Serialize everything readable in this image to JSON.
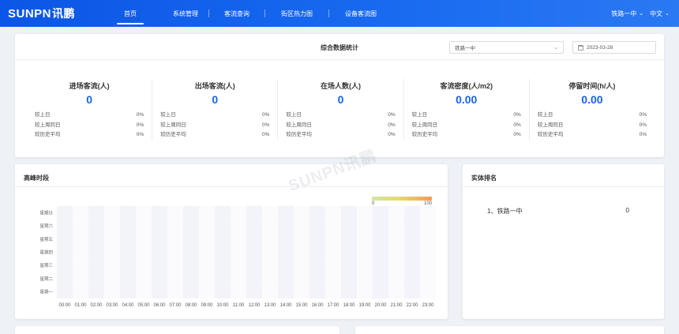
{
  "brand": {
    "logo_text": "SUNPN",
    "logo_cn": "讯鹏"
  },
  "nav": [
    {
      "label": "首页",
      "active": true
    },
    {
      "label": "系统管理"
    },
    {
      "label": "客流查询"
    },
    {
      "label": "街区热力图"
    },
    {
      "label": "设备客流图"
    }
  ],
  "header_right": {
    "store": "铁路一中",
    "language": "中文"
  },
  "stats": {
    "title": "综合数据统计",
    "store_select": "铁路一中",
    "date_value": "2023-03-28",
    "metrics": [
      {
        "label": "进场客流(人)",
        "value": "0",
        "rows": [
          {
            "name": "较上日",
            "pct": "0%"
          },
          {
            "name": "较上周同日",
            "pct": "0%"
          },
          {
            "name": "较历史平均",
            "pct": "0%"
          }
        ]
      },
      {
        "label": "出场客流(人)",
        "value": "0",
        "rows": [
          {
            "name": "较上日",
            "pct": "0%"
          },
          {
            "name": "较上周同日",
            "pct": "0%"
          },
          {
            "name": "较历史平均",
            "pct": "0%"
          }
        ]
      },
      {
        "label": "在场人数(人)",
        "value": "0",
        "rows": [
          {
            "name": "较上日",
            "pct": "0%"
          },
          {
            "name": "较上周同日",
            "pct": "0%"
          },
          {
            "name": "较历史平均",
            "pct": "0%"
          }
        ]
      },
      {
        "label": "客流密度(人/m2)",
        "value": "0.00",
        "rows": [
          {
            "name": "较上日",
            "pct": "0%"
          },
          {
            "name": "较上周同日",
            "pct": "0%"
          },
          {
            "name": "较历史平均",
            "pct": "0%"
          }
        ]
      },
      {
        "label": "停留时间(h/人)",
        "value": "0.00",
        "rows": [
          {
            "name": "较上日",
            "pct": "0%"
          },
          {
            "name": "较上周同日",
            "pct": "0%"
          },
          {
            "name": "较历史平均",
            "pct": "0%"
          }
        ]
      }
    ]
  },
  "peak": {
    "title": "高峰时段",
    "scale_min": "0",
    "scale_max": "100",
    "colors": {
      "low": "#cfe8a0",
      "mid": "#e6d870",
      "high": "#f59a55",
      "cell_a": "#f2f4f9",
      "cell_b": "#fbfbfd"
    }
  },
  "chart_data": {
    "type": "heatmap",
    "x": [
      "00:00",
      "01:00",
      "02:00",
      "03:00",
      "04:00",
      "05:00",
      "06:00",
      "07:00",
      "08:00",
      "09:00",
      "10:00",
      "11:00",
      "12:00",
      "13:00",
      "14:00",
      "15:00",
      "16:00",
      "17:00",
      "18:00",
      "19:00",
      "20:00",
      "21:00",
      "22:00",
      "23:00"
    ],
    "y": [
      "星期日",
      "星期六",
      "星期五",
      "星期四",
      "星期三",
      "星期二",
      "星期一"
    ],
    "values_all": 0,
    "visual_range": [
      0,
      100
    ]
  },
  "ranking": {
    "title": "实体排名",
    "items": [
      {
        "name": "1、铁路一中",
        "value": "0"
      }
    ]
  },
  "watermark": "SUNPN讯鹏"
}
